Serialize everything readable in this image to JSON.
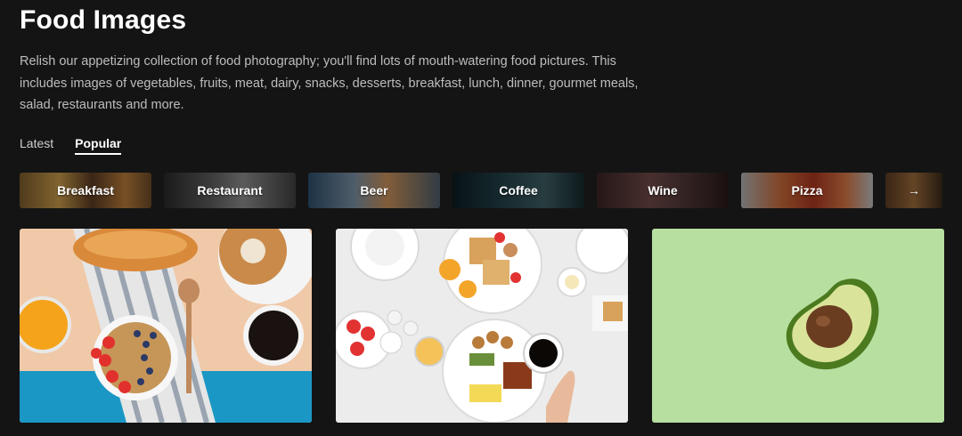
{
  "header": {
    "title": "Food Images",
    "description": "Relish our appetizing collection of food photography; you'll find lots of mouth-watering food pictures. This includes images of vegetables, fruits, meat, dairy, snacks, desserts, breakfast, lunch, dinner, gourmet meals, salad, restaurants and more."
  },
  "tabs": [
    {
      "label": "Latest",
      "active": false
    },
    {
      "label": "Popular",
      "active": true
    }
  ],
  "categories": [
    {
      "label": "Breakfast"
    },
    {
      "label": "Restaurant"
    },
    {
      "label": "Beer"
    },
    {
      "label": "Coffee"
    },
    {
      "label": "Wine"
    },
    {
      "label": "Pizza"
    }
  ],
  "more_icon": "arrow-right-icon",
  "photos": [
    {
      "subject": "breakfast-croissant-yogurt"
    },
    {
      "subject": "brunch-table-waffles-coffee"
    },
    {
      "subject": "avocado-on-green"
    }
  ],
  "colors": {
    "background": "#141414",
    "text": "#ffffff",
    "muted_text": "#bdbdbd",
    "avocado_bg": "#b7dfa0"
  }
}
